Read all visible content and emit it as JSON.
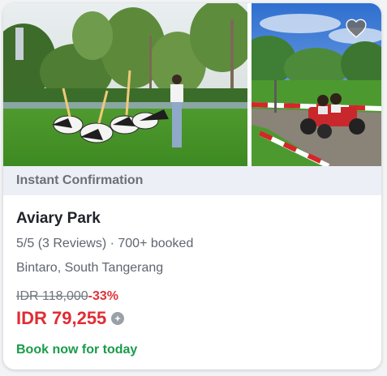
{
  "card": {
    "banner": "Instant Confirmation",
    "title": "Aviary Park",
    "rating_text": "5/5 (3 Reviews) · 700+ booked",
    "location": "Bintaro, South Tangerang",
    "original_price": "IDR 118,000",
    "discount": "-33%",
    "price": "IDR 79,255",
    "cta": "Book now for today"
  },
  "icons": {
    "favorite": "heart-icon",
    "price_info": "info-icon"
  },
  "colors": {
    "price": "#e02d34",
    "discount": "#e03238",
    "cta": "#1a9b4a",
    "banner_bg": "#eceff5"
  }
}
